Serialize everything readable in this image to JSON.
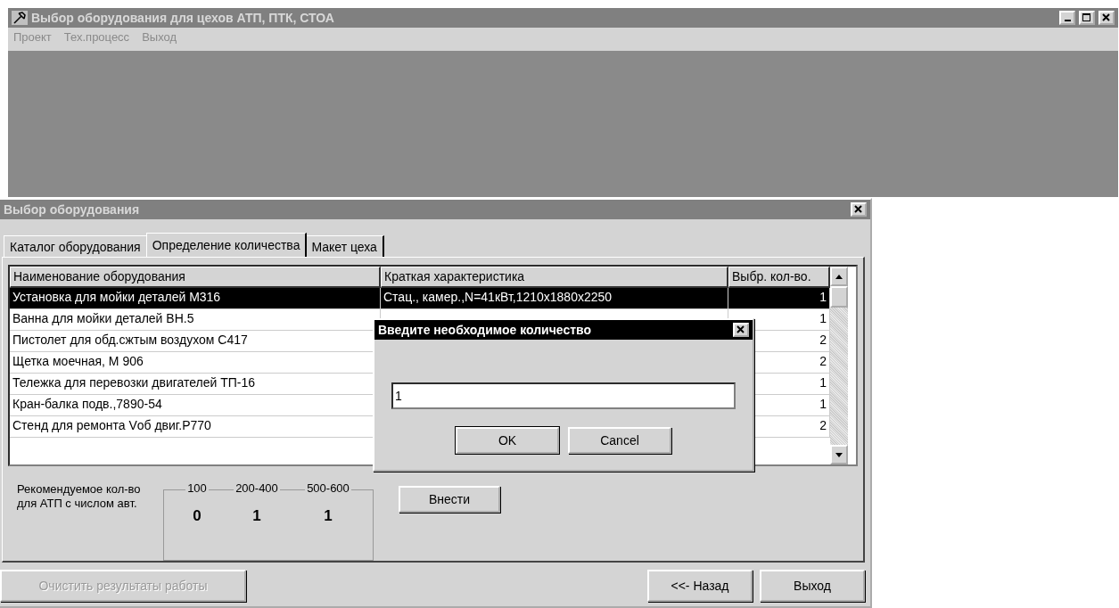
{
  "main_window": {
    "title": "Выбор оборудования для цехов АТП, ПТК, СТОА",
    "active": false,
    "menu": [
      "Проект",
      "Тех.процесс",
      "Выход"
    ]
  },
  "child_window": {
    "title": "Выбор оборудования",
    "active": false,
    "tabs": [
      {
        "label": "Каталог оборудования",
        "selected": false
      },
      {
        "label": "Определение количества",
        "selected": true
      },
      {
        "label": "Макет цеха",
        "selected": false
      }
    ],
    "table": {
      "columns": [
        "Наименование оборудования",
        "Краткая характеристика",
        "Выбр. кол-во."
      ],
      "rows": [
        {
          "name": "Установка для мойки деталей М316",
          "characteristic": "Стац., камер.,N=41кВт,1210x1880x2250",
          "quantity": "1",
          "selected": true
        },
        {
          "name": "Ванна для мойки деталей ВН.5",
          "quantity": "1",
          "selected": false
        },
        {
          "name": "Пистолет для обд.сжтым воздухом С417",
          "quantity": "2",
          "selected": false
        },
        {
          "name": "Щетка моечная, М 906",
          "quantity": "2",
          "selected": false
        },
        {
          "name": "Тележка для перевозки двигателей ТП-16",
          "quantity": "1",
          "selected": false
        },
        {
          "name": "Кран-балка подв.,7890-54",
          "quantity": "1",
          "selected": false
        },
        {
          "name": "Стенд для ремонта Vоб двиг.Р770",
          "quantity": "2",
          "selected": false
        }
      ]
    },
    "recommended": {
      "label": "Рекомендуемое кол-во для АТП с числом авт.",
      "groups": [
        {
          "range": "100",
          "value": "0"
        },
        {
          "range": "200-400",
          "value": "1"
        },
        {
          "range": "500-600",
          "value": "1"
        }
      ]
    },
    "submit_button": {
      "label": "Внести"
    },
    "clear_button": {
      "label": "Очистить результаты работы",
      "disabled": true
    },
    "back_button": {
      "label": "<<- Назад"
    },
    "exit_button": {
      "label": "Выход"
    }
  },
  "dialog": {
    "title": "Введите необходимое количество",
    "value": "1",
    "buttons": [
      {
        "label": "OK",
        "default": true
      },
      {
        "label": "Cancel",
        "default": false
      }
    ]
  }
}
